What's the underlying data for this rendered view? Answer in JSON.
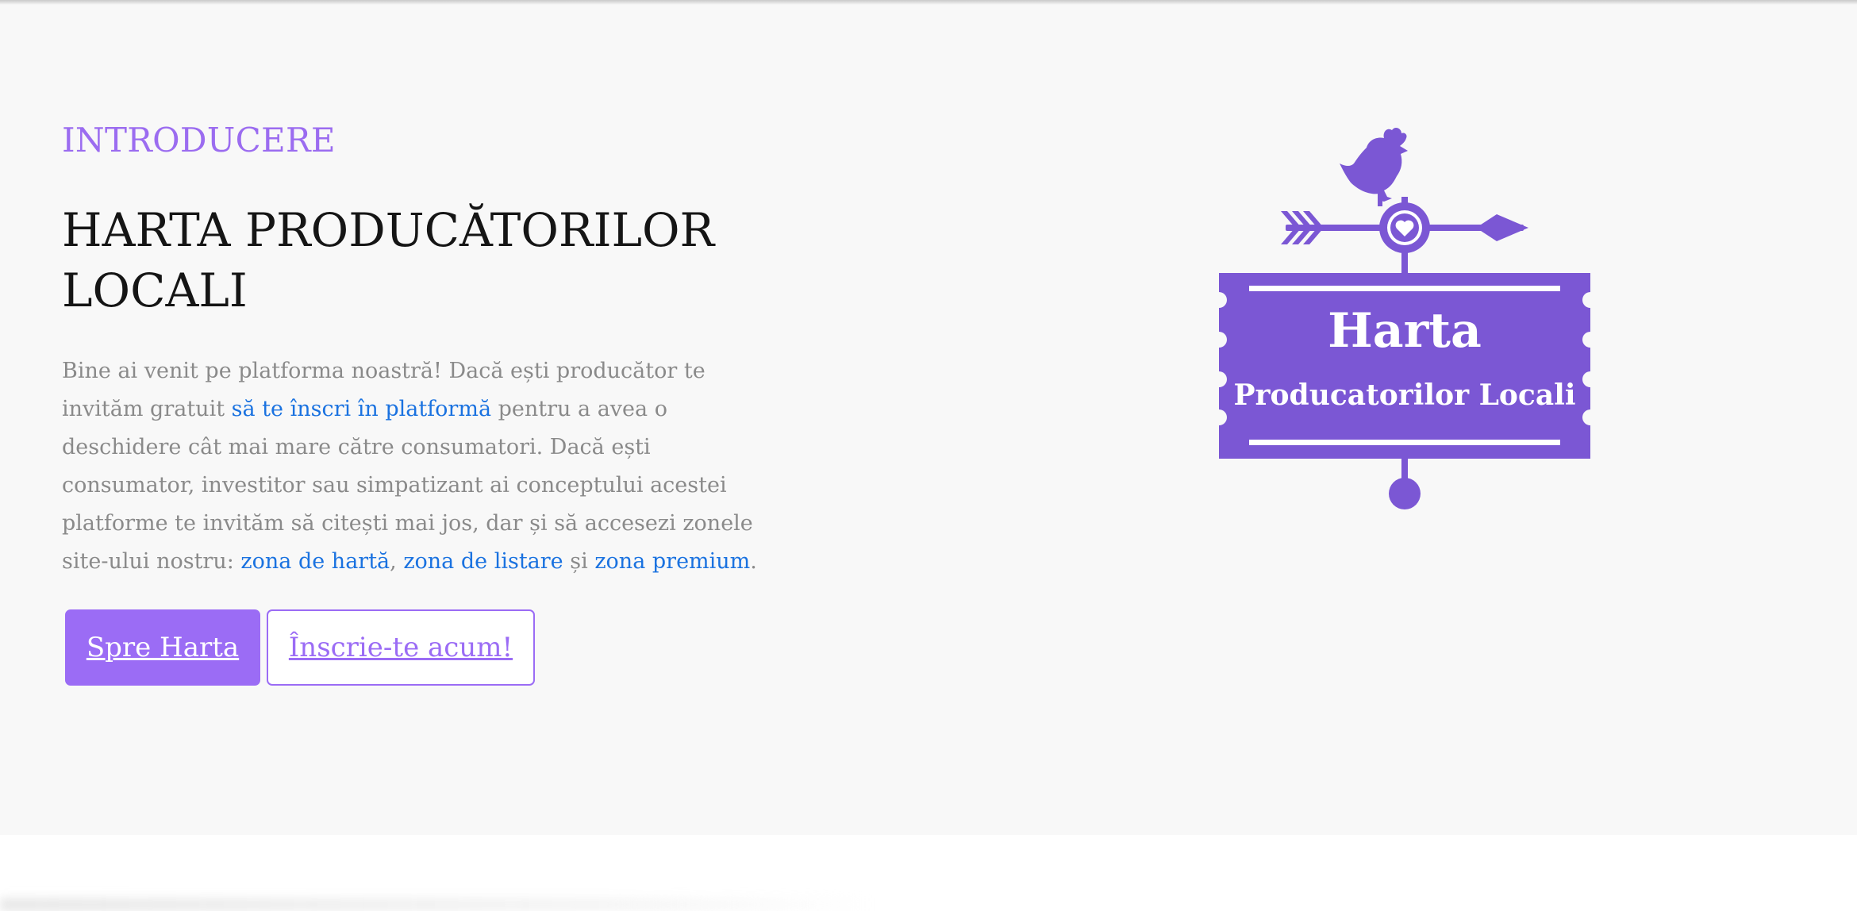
{
  "intro": {
    "eyebrow": "INTRODUCERE",
    "title": "HARTA PRODUCĂTORILOR LOCALI",
    "description": {
      "part1": "Bine ai venit pe platforma noastră! Dacă ești producător te invităm gratuit ",
      "link_signup": "să te înscri în platformă",
      "part2": " pentru a avea o deschidere cât mai mare către consumatori. Dacă ești consumator, investitor sau simpatizant ai conceptului acestei platforme te invităm să citești mai jos, dar și să accesezi zonele site-ului nostru: ",
      "link_map": "zona de hartă",
      "sep1": ", ",
      "link_listing": "zona de listare",
      "sep2": " și ",
      "link_premium": "zona premium",
      "end": "."
    },
    "buttons": {
      "primary_label": "Spre Harta",
      "secondary_label": "Înscrie-te acum!"
    }
  },
  "logo": {
    "title": "Harta",
    "subtitle": "Producatorilor Locali",
    "icons": [
      "rooster-icon",
      "arrow-icon",
      "heart-icon"
    ]
  },
  "colors": {
    "accent": "#9b6cf5",
    "logo_purple": "#7b57d4",
    "link": "#1a72e0",
    "text_muted": "#8a8a8a",
    "hero_background": "#f8f8f8"
  }
}
